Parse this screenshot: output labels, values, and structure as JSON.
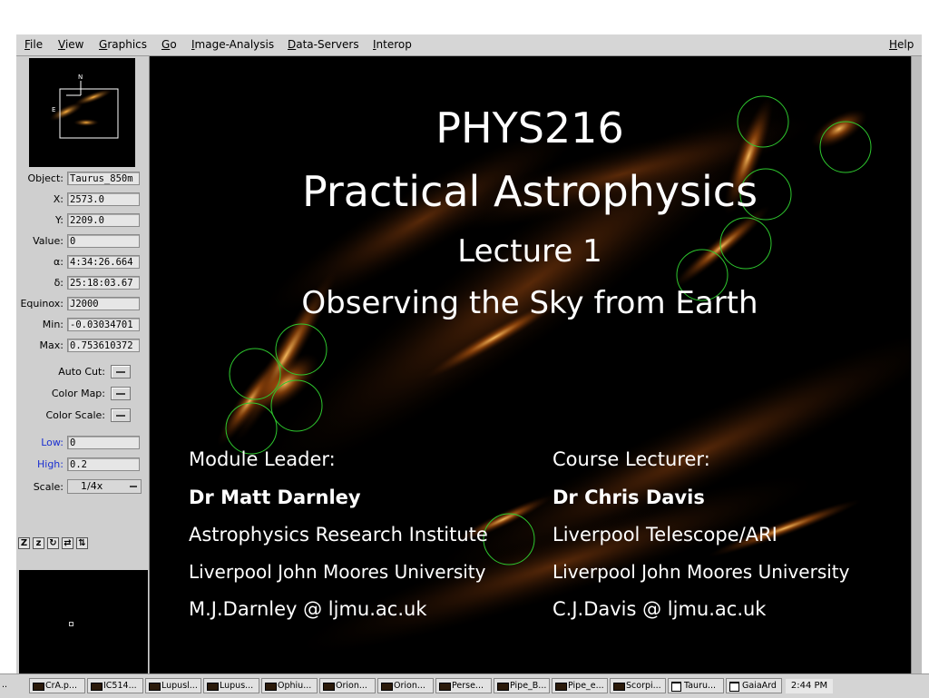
{
  "menu": [
    "File",
    "View",
    "Graphics",
    "Go",
    "Image-Analysis",
    "Data-Servers",
    "Interop"
  ],
  "help": "Help",
  "pan_labels": {
    "north": "N",
    "east": "E"
  },
  "fields": [
    {
      "label": "Object:",
      "value": "Taurus_850m"
    },
    {
      "label": "X:",
      "value": "2573.0"
    },
    {
      "label": "Y:",
      "value": "2209.0"
    },
    {
      "label": "Value:",
      "value": "0"
    },
    {
      "label": "α:",
      "value": "4:34:26.664"
    },
    {
      "label": "δ:",
      "value": "25:18:03.67"
    },
    {
      "label": "Equinox:",
      "value": "J2000"
    },
    {
      "label": "Min:",
      "value": "-0.03034701"
    },
    {
      "label": "Max:",
      "value": "0.753610372"
    }
  ],
  "options": [
    "Auto Cut:",
    "Color Map:",
    "Color Scale:"
  ],
  "low": {
    "label": "Low:",
    "value": "0"
  },
  "high": {
    "label": "High:",
    "value": "0.2"
  },
  "scale": {
    "label": "Scale:",
    "value": "1/4x"
  },
  "slide": {
    "title1": "PHYS216",
    "title2": "Practical Astrophysics",
    "title3": "Lecture 1",
    "title4": "Observing the Sky from Earth",
    "left": {
      "heading": "Module Leader:",
      "name": "Dr Matt Darnley",
      "line1": "Astrophysics Research Institute",
      "line2": "Liverpool John Moores University",
      "email": "M.J.Darnley  @  ljmu.ac.uk"
    },
    "right": {
      "heading": "Course Lecturer:",
      "name": "Dr Chris Davis",
      "line1": "Liverpool Telescope/ARI",
      "line2": "Liverpool John Moores University",
      "email": "C.J.Davis  @  ljmu.ac.uk"
    }
  },
  "taskbar": {
    "first": "..",
    "tasks": [
      "CrA.p...",
      "IC514...",
      "Lupusl...",
      "Lupus...",
      "Ophiu...",
      "Orion...",
      "Orion...",
      "Perse...",
      "Pipe_B...",
      "Pipe_e...",
      "Scorpi...",
      "Tauru...",
      "GaiaArd"
    ],
    "clock": "2:44 PM"
  }
}
